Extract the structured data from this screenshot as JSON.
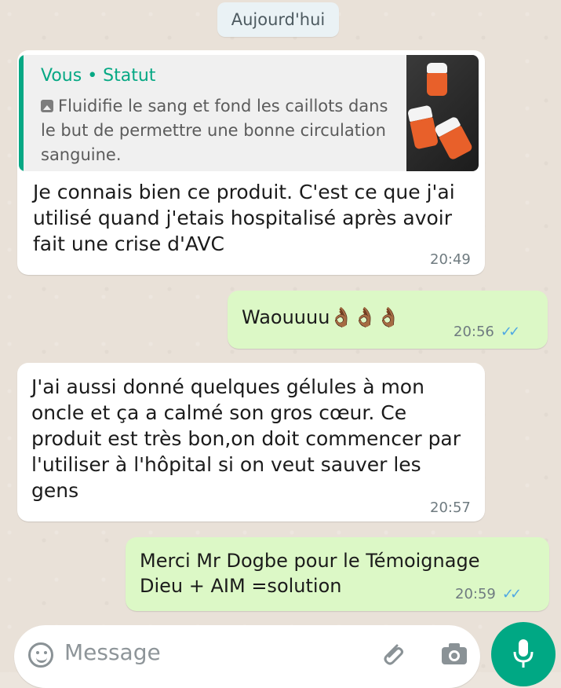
{
  "date_separator": "Aujourd'hui",
  "messages": [
    {
      "direction": "incoming",
      "quote": {
        "author": "Vous • Statut",
        "text": "Fluidifie le sang et fond les caillots dans le but de permettre une bonne circulation sanguine."
      },
      "text": "Je connais bien ce produit. C'est ce que j'ai utilisé quand j'etais hospitalisé après avoir fait une crise d'AVC",
      "time": "20:49"
    },
    {
      "direction": "outgoing",
      "text": "Waouuuu👌🏾👌🏾👌🏾",
      "time": "20:56",
      "ticks": "✓✓"
    },
    {
      "direction": "incoming",
      "text": "J'ai aussi donné quelques gélules à mon oncle et ça a calmé son gros cœur. Ce produit est très bon,on doit commencer par l'utiliser à l'hôpital si on veut sauver les gens",
      "time": "20:57"
    },
    {
      "direction": "outgoing",
      "text": "Merci Mr Dogbe pour le Témoignage\nDieu + AIM =solution",
      "time": "20:59",
      "ticks": "✓✓"
    }
  ],
  "input": {
    "placeholder": "Message"
  },
  "icons": {
    "emoji": "emoji-icon",
    "attach": "paperclip-icon",
    "camera": "camera-icon",
    "mic": "microphone-icon",
    "photo": "photo-icon"
  },
  "colors": {
    "incoming_bubble": "#ffffff",
    "outgoing_bubble": "#dcf8c6",
    "accent": "#06a884",
    "read_ticks": "#4fa8e3"
  }
}
